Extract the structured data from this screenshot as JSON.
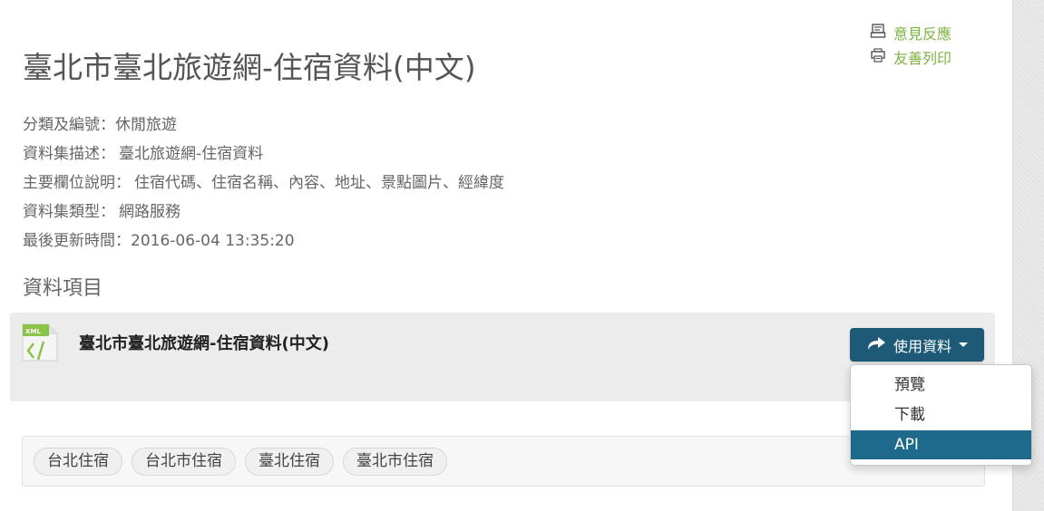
{
  "header": {
    "feedback_label": "意見反應",
    "feedback_icon": "feedback-icon",
    "print_label": "友善列印",
    "print_icon": "print-icon",
    "link_color": "#7cb342"
  },
  "title": "臺北市臺北旅遊網-住宿資料(中文)",
  "meta": [
    {
      "label": "分類及編號：",
      "value": "休閒旅遊"
    },
    {
      "label": "資料集描述：",
      "value": "臺北旅遊網-住宿資料"
    },
    {
      "label": "主要欄位說明：",
      "value": "住宿代碼、住宿名稱、內容、地址、景點圖片、經緯度"
    },
    {
      "label": "資料集類型：",
      "value": "網路服務"
    },
    {
      "label": "最後更新時間：",
      "value": "2016-06-04 13:35:20"
    }
  ],
  "resources": {
    "section_title": "資料項目",
    "item": {
      "file_icon": "xml-file-icon",
      "format_badge": "XML",
      "name": "臺北市臺北旅遊網-住宿資料(中文)"
    },
    "use_button": {
      "label": "使用資料",
      "icon": "share-arrow-icon",
      "color": "#1e5a78"
    },
    "dropdown": [
      {
        "label": "預覽",
        "active": false
      },
      {
        "label": "下載",
        "active": false
      },
      {
        "label": "API",
        "active": true
      }
    ]
  },
  "tags": [
    "台北住宿",
    "台北市住宿",
    "臺北住宿",
    "臺北市住宿"
  ]
}
